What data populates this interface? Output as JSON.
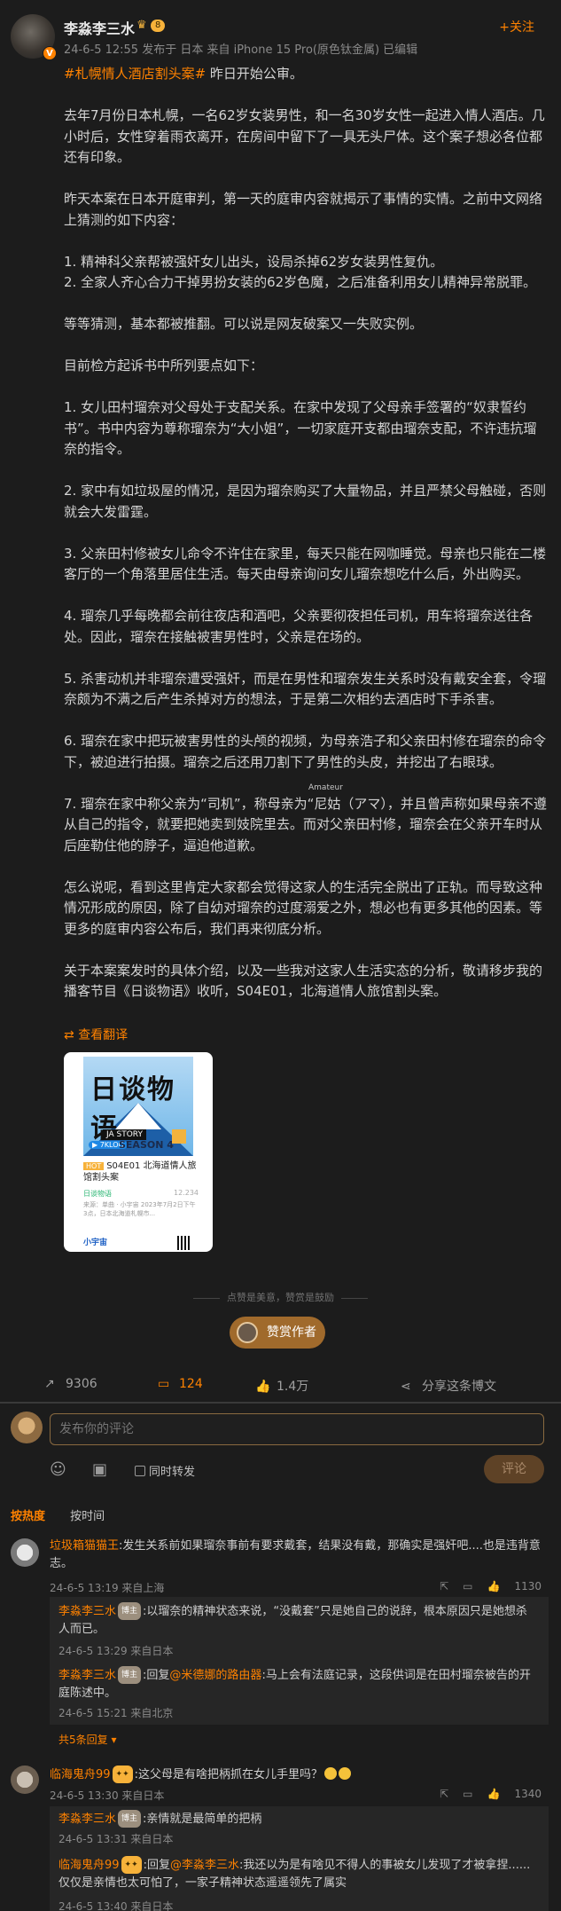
{
  "post": {
    "author": "李淼李三水",
    "level": "8",
    "verified_badge": "V",
    "meta": "24-6-5 12:55  发布于 日本  来自 iPhone 15 Pro(原色钛金属)  已编辑",
    "follow": "+关注",
    "hashtag": "#札幌情人酒店割头案#",
    "intro": " 昨日开始公审。",
    "paragraphs": [
      "去年7月份日本札幌，一名62岁女装男性，和一名30岁女性一起进入情人酒店。几小时后，女性穿着雨衣离开，在房间中留下了一具无头尸体。这个案子想必各位都还有印象。",
      "昨天本案在日本开庭审判，第一天的庭审内容就揭示了事情的实情。之前中文网络上猜测的如下内容：",
      "1. 精神科父亲帮被强奸女儿出头，设局杀掉62岁女装男性复仇。",
      "2. 全家人齐心合力干掉男扮女装的62岁色魔，之后准备利用女儿精神异常脱罪。",
      "等等猜测，基本都被推翻。可以说是网友破案又一失败实例。",
      "目前检方起诉书中所列要点如下：",
      "1. 女儿田村瑠奈对父母处于支配关系。在家中发现了父母亲手签署的“奴隶誓约书”。书中内容为尊称瑠奈为“大小姐”，一切家庭开支都由瑠奈支配，不许违抗瑠奈的指令。",
      "2. 家中有如垃圾屋的情况，是因为瑠奈购买了大量物品，并且严禁父母触碰，否则就会大发雷霆。",
      "3. 父亲田村修被女儿命令不许住在家里，每天只能在网咖睡觉。母亲也只能在二楼客厅的一个角落里居住生活。每天由母亲询问女儿瑠奈想吃什么后，外出购买。",
      "4. 瑠奈几乎每晚都会前往夜店和酒吧，父亲要彻夜担任司机，用车将瑠奈送往各处。因此，瑠奈在接触被害男性时，父亲是在场的。",
      "5. 杀害动机并非瑠奈遭受强奸，而是在男性和瑠奈发生关系时没有戴安全套，令瑠奈颇为不满之后产生杀掉对方的想法，于是第二次相约去酒店时下手杀害。",
      "6. 瑠奈在家中把玩被害男性的头颅的视频，为母亲浩子和父亲田村修在瑠奈的命令下，被迫进行拍摄。瑠奈之后还用刀割下了男性的头皮，并挖出了右眼球。",
      "7. 瑠奈在家中称父亲为“司机”，称母亲为“尼姑（アマ），并且曾声称如果母亲不遵从自己的指令，就要把她卖到妓院里去。而对父亲田村修，瑠奈会在父亲开车时从后座勒住他的脖子，逼迫他道歉。",
      "怎么说呢，看到这里肯定大家都会觉得这家人的生活完全脱出了正轨。而导致这种情况形成的原因，除了自幼对瑠奈的过度溺爱之外，想必也有更多其他的因素。等更多的庭审内容公布后，我们再来彻底分析。",
      "关于本案案发时的具体介绍，以及一些我对这家人生活实态的分析，敬请移步我的播客节目《日谈物语》收听，S04E01，北海道情人旅馆割头案。"
    ],
    "ruby": "Amateur",
    "translate": "查看翻译",
    "card": {
      "logo": "日谈物语",
      "story": "JA STORY",
      "season": "SEASON 4",
      "play": "▶ 7KLOG",
      "hot": "HOT",
      "title": "S04E01 北海道情人旅馆割头案",
      "author": "日谈物语",
      "count": "12.234",
      "desc": "来源：单曲 · 小宇宙  2023年7月2日下午3点，日本北海道札幌市...",
      "brand": "小宇宙"
    },
    "tip": "点赞是美意，赞赏是鼓励",
    "reward": "赞赏作者"
  },
  "actions": {
    "repost": "9306",
    "comment": "124",
    "like": "1.4万",
    "share": "分享这条博文"
  },
  "composer": {
    "placeholder": "发布你的评论",
    "repost_label": "同时转发",
    "submit": "评论"
  },
  "tabs": [
    "按热度",
    "按时间"
  ],
  "comments": [
    {
      "user": "垃圾箱猫猫王",
      "text": ":发生关系前如果瑠奈事前有要求戴套，结果没有戴，那确实是强奸吧....也是违背意志。",
      "meta": "24-6-5 13:19  来自上海",
      "likes": "1130",
      "replies": [
        {
          "user": "李淼李三水",
          "badge": "博主",
          "text": ":以瑠奈的精神状态来说，“没戴套”只是她自己的说辞，根本原因只是她想杀人而已。",
          "meta": "24-6-5 13:29  来自日本"
        },
        {
          "user": "李淼李三水",
          "badge": "博主",
          "prefix": ":回复",
          "mention": "@米德娜的路由器",
          "text": ":马上会有法庭记录，这段供词是在田村瑠奈被告的开庭陈述中。",
          "meta": "24-6-5 15:21  来自北京"
        }
      ],
      "more": "共5条回复"
    },
    {
      "user": "临海鬼舟99",
      "text": ":这父母是有啥把柄抓在女儿手里吗？",
      "meta": "24-6-5 13:30  来自日本",
      "likes": "1340",
      "replies": [
        {
          "user": "李淼李三水",
          "badge": "博主",
          "text": ":亲情就是最简单的把柄",
          "meta": "24-6-5 13:31  来自日本"
        },
        {
          "user": "临海鬼舟99",
          "prefix": ":回复",
          "mention": "@李淼李三水",
          "text": ":我还以为是有啥见不得人的事被女儿发现了才被拿捏......仅仅是亲情也太可怕了，一家子精神状态遥遥领先了属实",
          "meta": "24-6-5 13:40  来自日本"
        }
      ]
    }
  ],
  "colors": {
    "accent": "#ff8200",
    "background": "#1c1c1c",
    "text": "#d4d4d4",
    "muted": "#8a8a8a"
  }
}
